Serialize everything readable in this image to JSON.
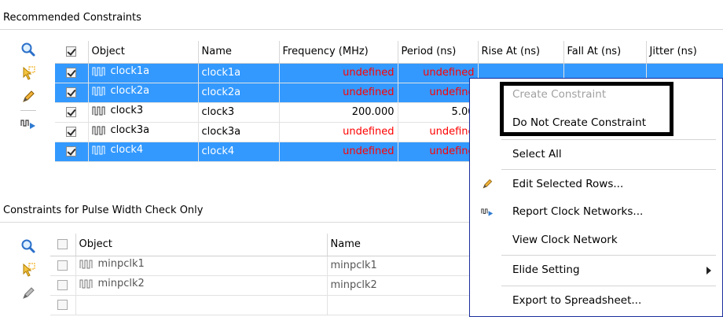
{
  "recommended": {
    "title": "Recommended Constraints",
    "columns": [
      "Object",
      "Name",
      "Frequency (MHz)",
      "Period (ns)",
      "Rise At (ns)",
      "Fall At (ns)",
      "Jitter (ns)"
    ],
    "rows": [
      {
        "object": "clock1a",
        "name": "clock1a",
        "frequency": "undefined",
        "period": "undefined",
        "selected": true
      },
      {
        "object": "clock2a",
        "name": "clock2a",
        "frequency": "undefined",
        "period": "undefine",
        "selected": true
      },
      {
        "object": "clock3",
        "name": "clock3",
        "frequency": "200.000",
        "period": "5.00",
        "selected": false
      },
      {
        "object": "clock3a",
        "name": "clock3a",
        "frequency": "undefined",
        "period": "undefine",
        "selected": false
      },
      {
        "object": "clock4",
        "name": "clock4",
        "frequency": "undefined",
        "period": "undefine",
        "selected": true
      }
    ]
  },
  "pulse": {
    "title": "Constraints for Pulse Width Check Only",
    "columns": [
      "Object",
      "Name"
    ],
    "rows": [
      {
        "object": "minpclk1",
        "name": "minpclk1"
      },
      {
        "object": "minpclk2",
        "name": "minpclk2"
      }
    ]
  },
  "menu": {
    "items": [
      {
        "label": "Create Constraint",
        "disabled": true
      },
      {
        "label": "Do Not Create Constraint",
        "disabled": false
      },
      {
        "label": "Select All",
        "disabled": false
      },
      {
        "label": "Edit Selected Rows...",
        "disabled": false,
        "icon": "pencil-icon"
      },
      {
        "label": "Report Clock Networks...",
        "disabled": false,
        "icon": "clock-network-report-icon"
      },
      {
        "label": "View Clock Network",
        "disabled": false
      },
      {
        "label": "Elide Setting",
        "disabled": false,
        "submenu": true
      },
      {
        "label": "Export to Spreadsheet...",
        "disabled": false
      }
    ]
  },
  "colors": {
    "selection": "#3399ff",
    "undefined_text": "#ff0000",
    "menu_border": "#1a2f9c",
    "highlight_box": "#000000"
  },
  "icons": [
    "search-icon",
    "select-arrow-icon",
    "pencil-icon",
    "clock-network-report-icon",
    "clock-waveform-icon",
    "submenu-arrow-icon"
  ]
}
